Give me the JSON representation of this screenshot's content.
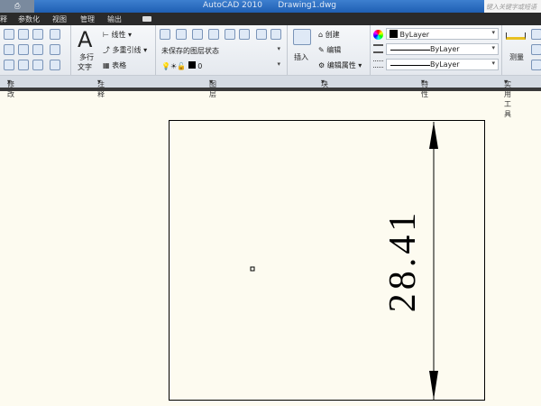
{
  "title_bar": {
    "app_title": "AutoCAD 2010",
    "document": "Drawing1.dwg",
    "search_placeholder": "键入关键字或短语"
  },
  "tabs": [
    "释",
    "参数化",
    "视图",
    "管理",
    "输出"
  ],
  "panels": {
    "modify": {
      "label": "修改"
    },
    "annotation": {
      "label": "注释",
      "multiline_text": "多行",
      "multiline_text2": "文字",
      "linear": "线性",
      "multileader": "多重引线",
      "table": "表格",
      "big_icon": "A"
    },
    "layers": {
      "label": "图层",
      "layer_state": "未保存的图层状态",
      "current_layer": "0"
    },
    "block": {
      "label": "块",
      "insert": "插入",
      "create": "创建",
      "edit": "编辑",
      "edit_attributes": "编辑属性"
    },
    "properties": {
      "label": "特性",
      "color": "ByLayer",
      "linetype": "ByLayer",
      "lineweight": "ByLayer"
    },
    "utilities": {
      "label": "实用工具",
      "measure": "测量"
    }
  },
  "drawing": {
    "dimension_text": "28.41",
    "background": "#fdfbf0"
  }
}
